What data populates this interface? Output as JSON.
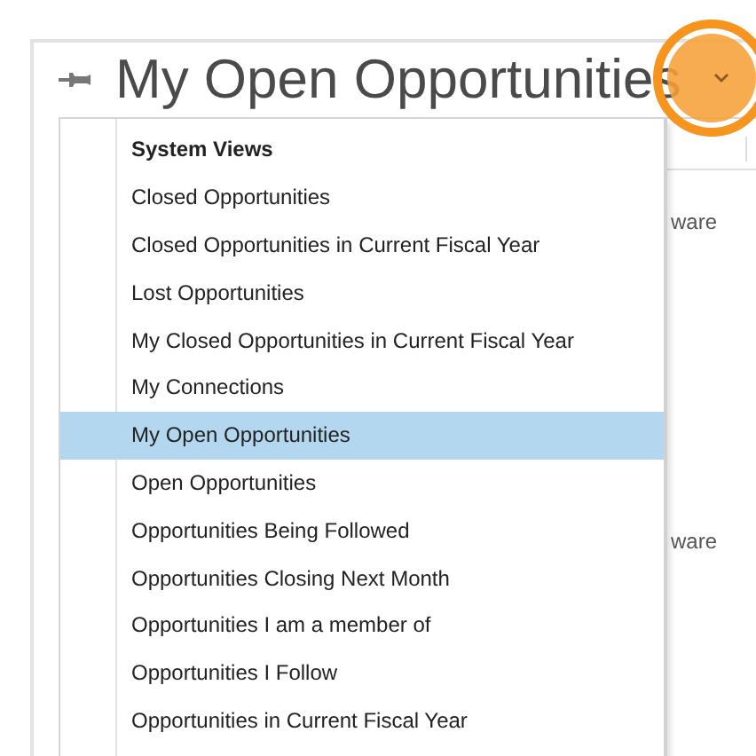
{
  "header": {
    "title": "My Open Opportunities"
  },
  "menu": {
    "items": [
      {
        "kind": "heading",
        "label": "System Views"
      },
      {
        "kind": "view",
        "label": "Closed Opportunities",
        "selected": false
      },
      {
        "kind": "view",
        "label": "Closed Opportunities in Current Fiscal Year",
        "selected": false
      },
      {
        "kind": "view",
        "label": "Lost Opportunities",
        "selected": false
      },
      {
        "kind": "view",
        "label": "My Closed Opportunities in Current Fiscal Year",
        "selected": false
      },
      {
        "kind": "view",
        "label": "My Connections",
        "selected": false
      },
      {
        "kind": "view",
        "label": "My Open Opportunities",
        "selected": true
      },
      {
        "kind": "view",
        "label": "Open Opportunities",
        "selected": false
      },
      {
        "kind": "view",
        "label": "Opportunities Being Followed",
        "selected": false
      },
      {
        "kind": "view",
        "label": "Opportunities Closing Next Month",
        "selected": false
      },
      {
        "kind": "view",
        "label": "Opportunities I am a member of",
        "selected": false
      },
      {
        "kind": "view",
        "label": "Opportunities I Follow",
        "selected": false
      },
      {
        "kind": "view",
        "label": "Opportunities in Current Fiscal Year",
        "selected": false
      }
    ]
  },
  "grid": {
    "cells": [
      "ware",
      "ware"
    ]
  }
}
